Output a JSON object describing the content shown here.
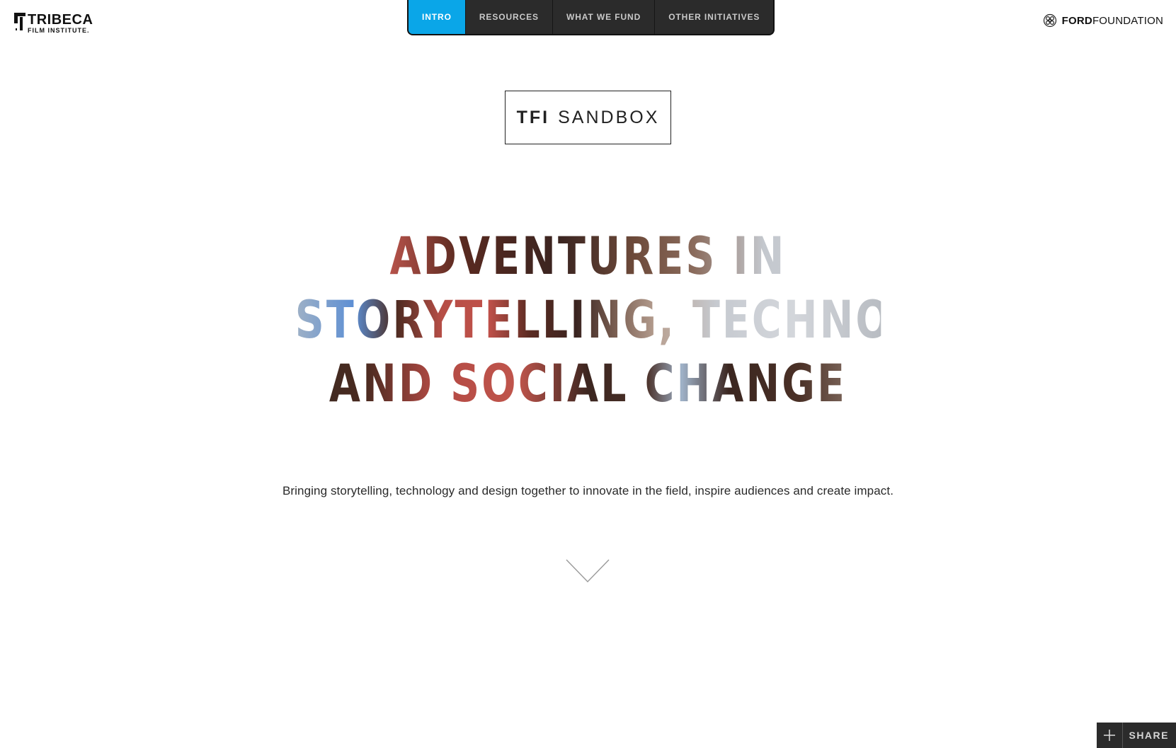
{
  "header": {
    "tribeca": {
      "name": "TRIBECA",
      "sub": "FILM INSTITUTE."
    },
    "nav": [
      {
        "label": "INTRO",
        "active": true
      },
      {
        "label": "RESOURCES",
        "active": false
      },
      {
        "label": "WHAT WE FUND",
        "active": false
      },
      {
        "label": "OTHER INITIATIVES",
        "active": false
      }
    ],
    "ford": {
      "bold": "FORD",
      "light": "FOUNDATION"
    }
  },
  "hero": {
    "badge": {
      "tfi": "TFI",
      "sandbox": "SANDBOX"
    },
    "headline_lines": [
      "ADVENTURES IN",
      "STORYTELLING, TECHNOLOGY",
      "AND SOCIAL CHANGE"
    ],
    "tagline": "Bringing storytelling, technology and design together to innovate in the field, inspire audiences and create impact."
  },
  "share": {
    "label": "SHARE"
  },
  "icons": {
    "scroll": "chevron-down-icon",
    "share": "plus-icon",
    "ford": "ford-foundation-icon"
  },
  "colors": {
    "nav_active": "#0aa6e8",
    "nav_bg": "#2b2b2b",
    "share_bg": "#2b2b2b"
  }
}
